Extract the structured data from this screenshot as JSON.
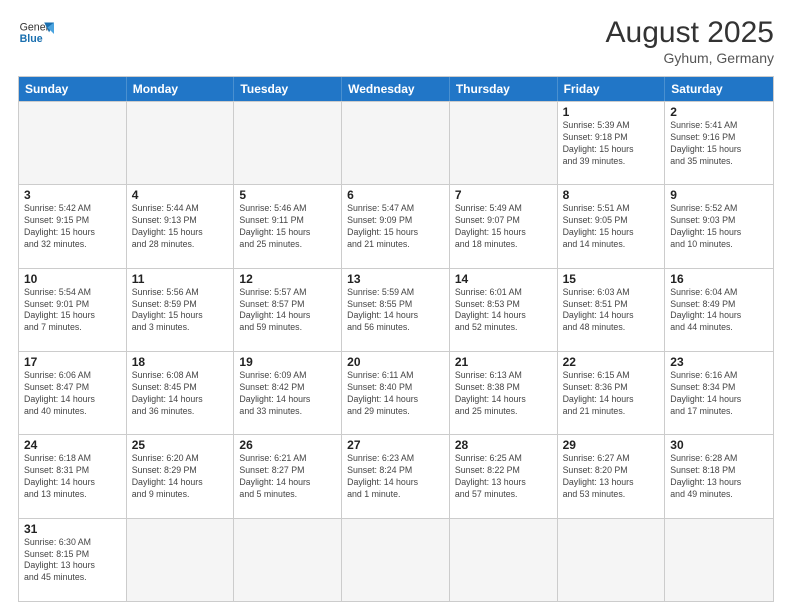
{
  "header": {
    "logo_general": "General",
    "logo_blue": "Blue",
    "month_year": "August 2025",
    "location": "Gyhum, Germany"
  },
  "weekdays": [
    "Sunday",
    "Monday",
    "Tuesday",
    "Wednesday",
    "Thursday",
    "Friday",
    "Saturday"
  ],
  "rows": [
    [
      {
        "day": "",
        "info": ""
      },
      {
        "day": "",
        "info": ""
      },
      {
        "day": "",
        "info": ""
      },
      {
        "day": "",
        "info": ""
      },
      {
        "day": "",
        "info": ""
      },
      {
        "day": "1",
        "info": "Sunrise: 5:39 AM\nSunset: 9:18 PM\nDaylight: 15 hours\nand 39 minutes."
      },
      {
        "day": "2",
        "info": "Sunrise: 5:41 AM\nSunset: 9:16 PM\nDaylight: 15 hours\nand 35 minutes."
      }
    ],
    [
      {
        "day": "3",
        "info": "Sunrise: 5:42 AM\nSunset: 9:15 PM\nDaylight: 15 hours\nand 32 minutes."
      },
      {
        "day": "4",
        "info": "Sunrise: 5:44 AM\nSunset: 9:13 PM\nDaylight: 15 hours\nand 28 minutes."
      },
      {
        "day": "5",
        "info": "Sunrise: 5:46 AM\nSunset: 9:11 PM\nDaylight: 15 hours\nand 25 minutes."
      },
      {
        "day": "6",
        "info": "Sunrise: 5:47 AM\nSunset: 9:09 PM\nDaylight: 15 hours\nand 21 minutes."
      },
      {
        "day": "7",
        "info": "Sunrise: 5:49 AM\nSunset: 9:07 PM\nDaylight: 15 hours\nand 18 minutes."
      },
      {
        "day": "8",
        "info": "Sunrise: 5:51 AM\nSunset: 9:05 PM\nDaylight: 15 hours\nand 14 minutes."
      },
      {
        "day": "9",
        "info": "Sunrise: 5:52 AM\nSunset: 9:03 PM\nDaylight: 15 hours\nand 10 minutes."
      }
    ],
    [
      {
        "day": "10",
        "info": "Sunrise: 5:54 AM\nSunset: 9:01 PM\nDaylight: 15 hours\nand 7 minutes."
      },
      {
        "day": "11",
        "info": "Sunrise: 5:56 AM\nSunset: 8:59 PM\nDaylight: 15 hours\nand 3 minutes."
      },
      {
        "day": "12",
        "info": "Sunrise: 5:57 AM\nSunset: 8:57 PM\nDaylight: 14 hours\nand 59 minutes."
      },
      {
        "day": "13",
        "info": "Sunrise: 5:59 AM\nSunset: 8:55 PM\nDaylight: 14 hours\nand 56 minutes."
      },
      {
        "day": "14",
        "info": "Sunrise: 6:01 AM\nSunset: 8:53 PM\nDaylight: 14 hours\nand 52 minutes."
      },
      {
        "day": "15",
        "info": "Sunrise: 6:03 AM\nSunset: 8:51 PM\nDaylight: 14 hours\nand 48 minutes."
      },
      {
        "day": "16",
        "info": "Sunrise: 6:04 AM\nSunset: 8:49 PM\nDaylight: 14 hours\nand 44 minutes."
      }
    ],
    [
      {
        "day": "17",
        "info": "Sunrise: 6:06 AM\nSunset: 8:47 PM\nDaylight: 14 hours\nand 40 minutes."
      },
      {
        "day": "18",
        "info": "Sunrise: 6:08 AM\nSunset: 8:45 PM\nDaylight: 14 hours\nand 36 minutes."
      },
      {
        "day": "19",
        "info": "Sunrise: 6:09 AM\nSunset: 8:42 PM\nDaylight: 14 hours\nand 33 minutes."
      },
      {
        "day": "20",
        "info": "Sunrise: 6:11 AM\nSunset: 8:40 PM\nDaylight: 14 hours\nand 29 minutes."
      },
      {
        "day": "21",
        "info": "Sunrise: 6:13 AM\nSunset: 8:38 PM\nDaylight: 14 hours\nand 25 minutes."
      },
      {
        "day": "22",
        "info": "Sunrise: 6:15 AM\nSunset: 8:36 PM\nDaylight: 14 hours\nand 21 minutes."
      },
      {
        "day": "23",
        "info": "Sunrise: 6:16 AM\nSunset: 8:34 PM\nDaylight: 14 hours\nand 17 minutes."
      }
    ],
    [
      {
        "day": "24",
        "info": "Sunrise: 6:18 AM\nSunset: 8:31 PM\nDaylight: 14 hours\nand 13 minutes."
      },
      {
        "day": "25",
        "info": "Sunrise: 6:20 AM\nSunset: 8:29 PM\nDaylight: 14 hours\nand 9 minutes."
      },
      {
        "day": "26",
        "info": "Sunrise: 6:21 AM\nSunset: 8:27 PM\nDaylight: 14 hours\nand 5 minutes."
      },
      {
        "day": "27",
        "info": "Sunrise: 6:23 AM\nSunset: 8:24 PM\nDaylight: 14 hours\nand 1 minute."
      },
      {
        "day": "28",
        "info": "Sunrise: 6:25 AM\nSunset: 8:22 PM\nDaylight: 13 hours\nand 57 minutes."
      },
      {
        "day": "29",
        "info": "Sunrise: 6:27 AM\nSunset: 8:20 PM\nDaylight: 13 hours\nand 53 minutes."
      },
      {
        "day": "30",
        "info": "Sunrise: 6:28 AM\nSunset: 8:18 PM\nDaylight: 13 hours\nand 49 minutes."
      }
    ],
    [
      {
        "day": "31",
        "info": "Sunrise: 6:30 AM\nSunset: 8:15 PM\nDaylight: 13 hours\nand 45 minutes."
      },
      {
        "day": "",
        "info": ""
      },
      {
        "day": "",
        "info": ""
      },
      {
        "day": "",
        "info": ""
      },
      {
        "day": "",
        "info": ""
      },
      {
        "day": "",
        "info": ""
      },
      {
        "day": "",
        "info": ""
      }
    ]
  ]
}
